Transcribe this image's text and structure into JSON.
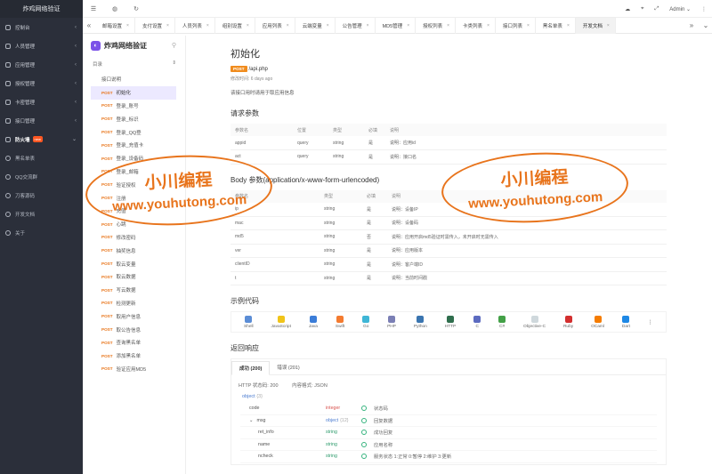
{
  "app": {
    "title": "炸鸡网络验证"
  },
  "sidebar": {
    "items": [
      {
        "label": "控制台",
        "arrow": "‹"
      },
      {
        "label": "人员管理",
        "arrow": "‹"
      },
      {
        "label": "应用管理",
        "arrow": "‹"
      },
      {
        "label": "授权管理",
        "arrow": "‹"
      },
      {
        "label": "卡密管理",
        "arrow": "‹"
      },
      {
        "label": "接口管理",
        "arrow": "‹"
      },
      {
        "label": "防火墙",
        "badge": "new",
        "arrow": "⌄"
      }
    ],
    "subitems": [
      {
        "label": "黑名单表"
      },
      {
        "label": "QQ交流群"
      },
      {
        "label": "刀客源码"
      },
      {
        "label": "开发文档"
      },
      {
        "label": "关于"
      }
    ]
  },
  "topbar": {
    "user": "Admin",
    "user_arrow": "⌄"
  },
  "tabs": [
    {
      "label": "邮箱设置"
    },
    {
      "label": "支付设置"
    },
    {
      "label": "人员列表"
    },
    {
      "label": "组别设置"
    },
    {
      "label": "应用列表"
    },
    {
      "label": "云端变量"
    },
    {
      "label": "公告管理"
    },
    {
      "label": "MD5管理"
    },
    {
      "label": "授权列表"
    },
    {
      "label": "卡类列表"
    },
    {
      "label": "接口列表"
    },
    {
      "label": "黑名单表"
    },
    {
      "label": "开发文档"
    }
  ],
  "docside": {
    "brand": "炸鸡网络验证",
    "dir_label": "目录",
    "links": [
      {
        "label": "接口说明",
        "method": ""
      },
      {
        "label": "初始化",
        "method": "POST"
      },
      {
        "label": "登录_账号",
        "method": "POST"
      },
      {
        "label": "登录_标识",
        "method": "POST"
      },
      {
        "label": "登录_QQ登",
        "method": "POST"
      },
      {
        "label": "登录_充值卡",
        "method": "POST"
      },
      {
        "label": "登录_设备码",
        "method": "POST"
      },
      {
        "label": "登录_邮箱",
        "method": "POST"
      },
      {
        "label": "验证授权",
        "method": "POST"
      },
      {
        "label": "注册",
        "method": "POST"
      },
      {
        "label": "充值",
        "method": "POST"
      },
      {
        "label": "心跳",
        "method": "POST"
      },
      {
        "label": "修改密码",
        "method": "POST"
      },
      {
        "label": "抽奖信息",
        "method": "POST"
      },
      {
        "label": "取云变量",
        "method": "POST"
      },
      {
        "label": "取云数据",
        "method": "POST"
      },
      {
        "label": "写云数据",
        "method": "POST"
      },
      {
        "label": "检测更新",
        "method": "POST"
      },
      {
        "label": "取用户信息",
        "method": "POST"
      },
      {
        "label": "取公告信息",
        "method": "POST"
      },
      {
        "label": "查询黑名单",
        "method": "POST"
      },
      {
        "label": "添加黑名单",
        "method": "POST"
      },
      {
        "label": "验证应用MD5",
        "method": "POST"
      }
    ]
  },
  "doc": {
    "title": "初始化",
    "method": "POST",
    "path": "/api.php",
    "modified": "修改时间: 6 days ago",
    "description": "该接口用时请用于取应用信息",
    "query_title": "请求参数",
    "query_headers": [
      "参数名",
      "位置",
      "类型",
      "必填",
      "说明"
    ],
    "query_rows": [
      [
        "appid",
        "query",
        "string",
        "是",
        "说明：应用id"
      ],
      [
        "act",
        "query",
        "string",
        "是",
        "说明：接口名"
      ]
    ],
    "body_title": "Body 参数(application/x-www-form-urlencoded)",
    "body_headers": [
      "参数名",
      "类型",
      "必填",
      "说明"
    ],
    "body_rows": [
      [
        "ip",
        "string",
        "是",
        "说明：设备IP"
      ],
      [
        "mac",
        "string",
        "是",
        "说明：设备码"
      ],
      [
        "md5",
        "string",
        "否",
        "说明：应用开启md5验证时需传入，未开启时无需传入"
      ],
      [
        "ver",
        "string",
        "是",
        "说明：应用版本"
      ],
      [
        "clientID",
        "string",
        "是",
        "说明：客户端ID"
      ],
      [
        "t",
        "string",
        "是",
        "说明：当前时间戳"
      ]
    ],
    "code_title": "示例代码",
    "languages": [
      {
        "name": "Shell",
        "color": "#5b8dd6"
      },
      {
        "name": "JavaScript",
        "color": "#f0c419"
      },
      {
        "name": "Java",
        "color": "#3b7dd8"
      },
      {
        "name": "Swift",
        "color": "#f47b30"
      },
      {
        "name": "Go",
        "color": "#3fb6d6"
      },
      {
        "name": "PHP",
        "color": "#7b7fb5"
      },
      {
        "name": "Python",
        "color": "#3a75b0"
      },
      {
        "name": "HTTP",
        "color": "#2f6e4d"
      },
      {
        "name": "C",
        "color": "#5c6bc0"
      },
      {
        "name": "C#",
        "color": "#43a047"
      },
      {
        "name": "Objective-C",
        "color": "#cfd8dc"
      },
      {
        "name": "Ruby",
        "color": "#d32f2f"
      },
      {
        "name": "OCaml",
        "color": "#f57c00"
      },
      {
        "name": "Dart",
        "color": "#1e88e5"
      }
    ],
    "more_langs": "⋮",
    "response_title": "返回响应",
    "resp_tabs": [
      "成功 (200)",
      "错误 (201)"
    ],
    "http_status": "HTTP 状态码: 200",
    "content_type": "内容格式: JSON",
    "object_label": "object",
    "object_count": "{3}",
    "fields": [
      {
        "name": "code",
        "type": "integer",
        "desc": "状态码",
        "indent": 0
      },
      {
        "name": "msg",
        "type": "object",
        "type_suffix": "{12}",
        "desc": "回复数据",
        "indent": 0,
        "caret": "⌄"
      },
      {
        "name": "ret_info",
        "type": "string",
        "desc": "成功回复",
        "indent": 1
      },
      {
        "name": "name",
        "type": "string",
        "desc": "应用名称",
        "indent": 1
      },
      {
        "name": "ncheck",
        "type": "string",
        "desc": "服务状态 1:正常 0:暂停 2:维护 3:更新",
        "indent": 1
      }
    ]
  },
  "watermark": {
    "line1": "小川编程",
    "line2": "www.youhutong.com"
  }
}
